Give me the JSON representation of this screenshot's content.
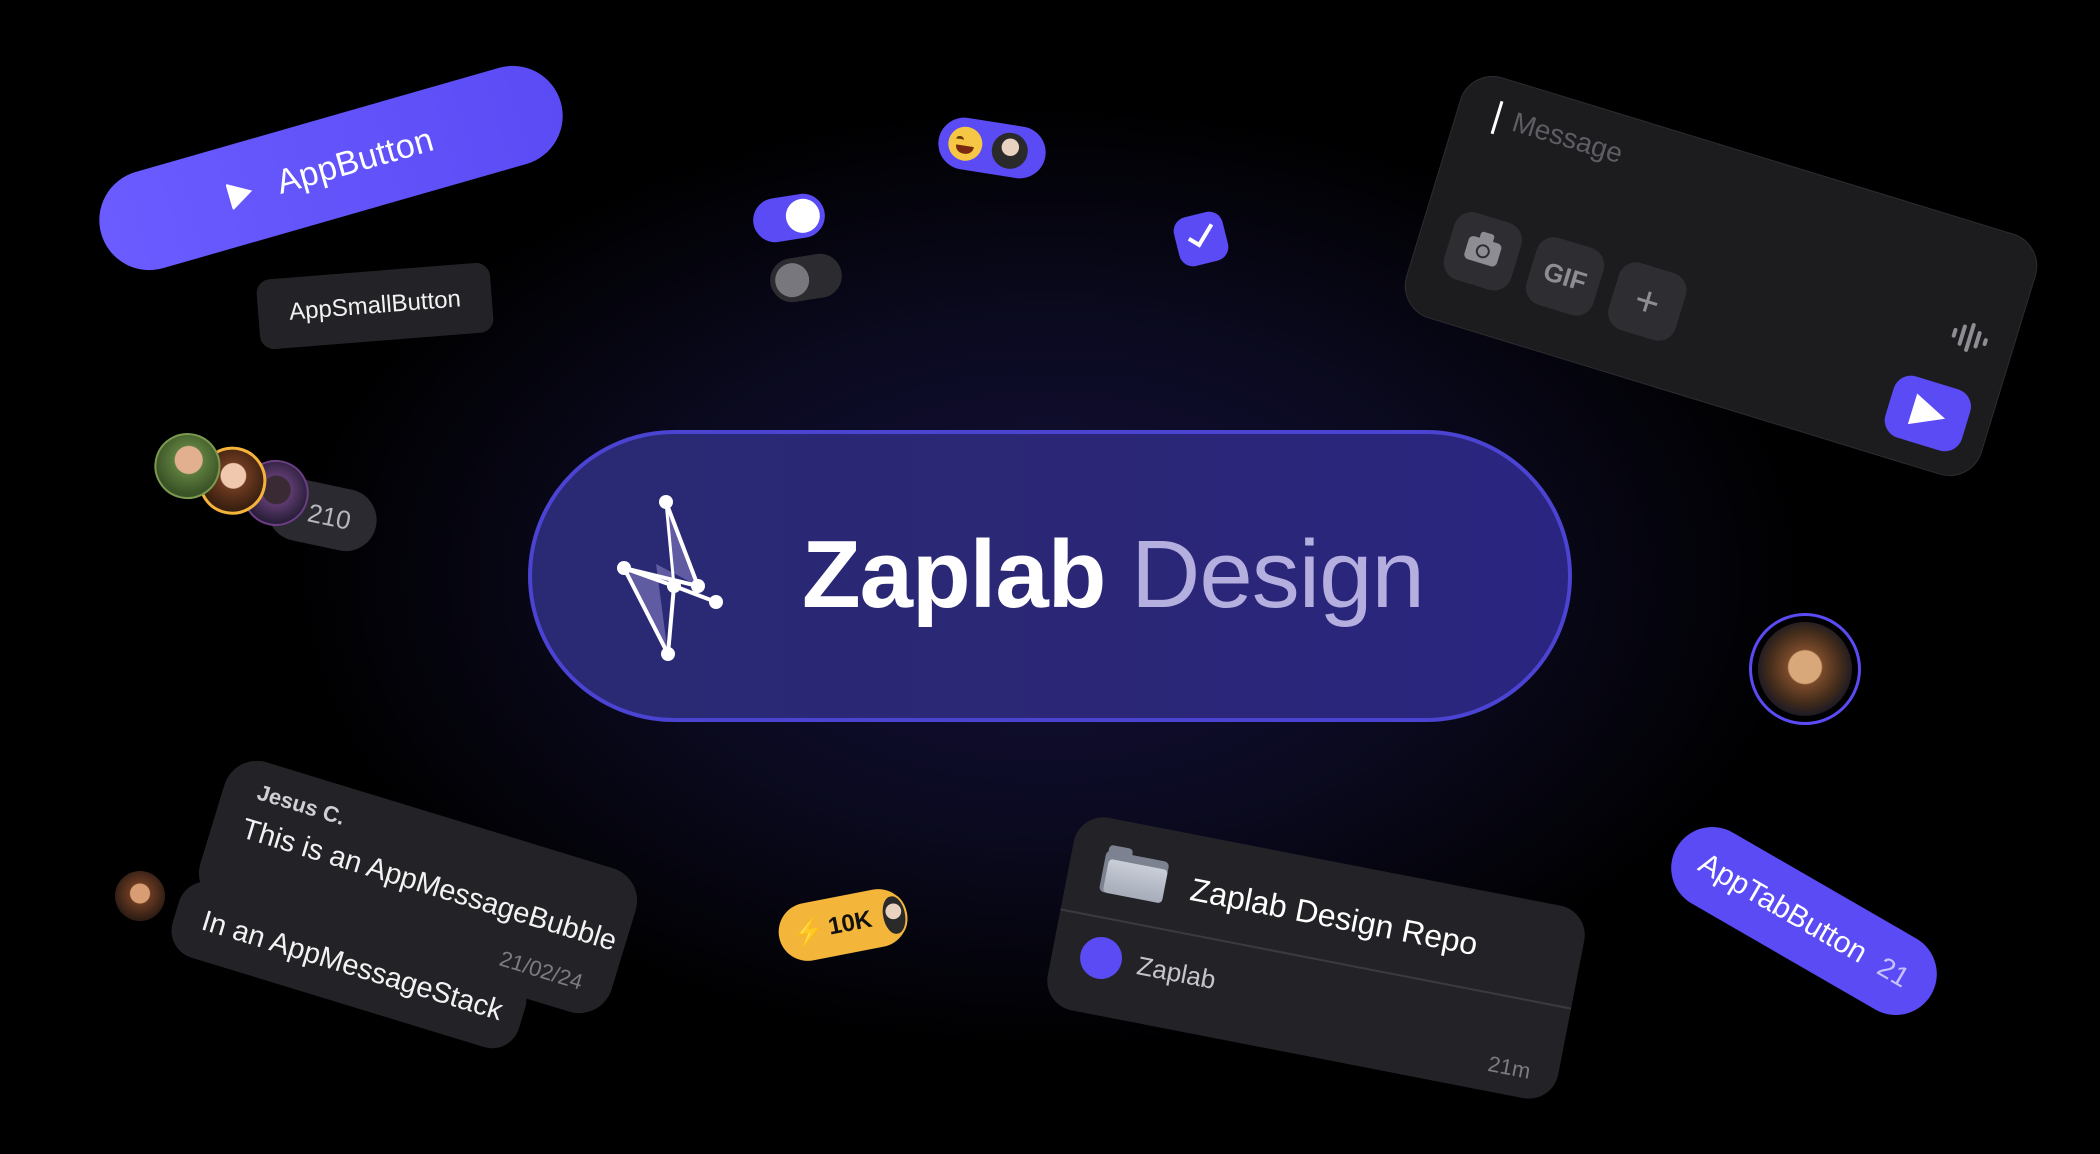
{
  "app_button": {
    "label": "AppButton",
    "icon": "play-icon"
  },
  "app_small_button": {
    "label": "AppSmallButton"
  },
  "toggles": [
    {
      "state": "on"
    },
    {
      "state": "off"
    }
  ],
  "reaction": {
    "emoji": "😂",
    "icons": [
      "laughing-emoji-icon",
      "avatar"
    ]
  },
  "checkbox": {
    "checked": true
  },
  "composer": {
    "placeholder": "Message",
    "buttons": {
      "camera": "camera-icon",
      "gif": "GIF",
      "plus": "+"
    },
    "voice_icon": "waveform-icon",
    "send_icon": "send-icon"
  },
  "avatar_stack": {
    "count": "210"
  },
  "hero": {
    "title_bold": "Zaplab",
    "title_light": "Design",
    "logo": "zaplab-logo-icon"
  },
  "message": {
    "author": "Jesus C.",
    "text": "This is an AppMessageBubble",
    "date": "21/02/24",
    "stack_text": "In an AppMessageStack"
  },
  "badge": {
    "count": "10K",
    "icon": "bolt-icon"
  },
  "repo": {
    "title": "Zaplab Design Repo",
    "owner": "Zaplab",
    "time": "21m"
  },
  "tab_button": {
    "label": "AppTabButton",
    "count": "21"
  },
  "colors": {
    "accent": "#5b4bf5",
    "card": "#232327",
    "badge": "#f3b63a"
  }
}
